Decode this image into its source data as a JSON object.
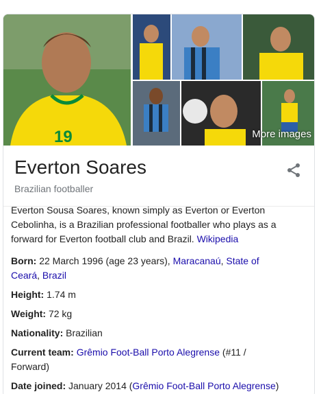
{
  "gallery": {
    "more_images_label": "More images",
    "tiles": [
      "main-portrait",
      "photo-2",
      "photo-3",
      "photo-4",
      "photo-5",
      "photo-6",
      "photo-7"
    ]
  },
  "entity": {
    "name": "Everton Soares",
    "type": "Brazilian footballer",
    "share_icon": "share-icon"
  },
  "description": {
    "text": "Everton Sousa Soares, known simply as Everton or Everton Cebolinha, is a Brazilian professional footballer who plays as a forward for Everton football club and Brazil. ",
    "source_label": "Wikipedia"
  },
  "facts": {
    "born": {
      "label": "Born:",
      "value": " 22 March 1996 (age 23 years), ",
      "link1": "Maracanaú",
      "sep": ", ",
      "link2": "State of Ceará",
      "sep2": ", ",
      "link3": "Brazil"
    },
    "height": {
      "label": "Height:",
      "value": " 1.74 m"
    },
    "weight": {
      "label": "Weight:",
      "value": " 72 kg"
    },
    "nationality": {
      "label": "Nationality:",
      "value": " Brazilian"
    },
    "current_team": {
      "label": "Current team:",
      "link": "Grêmio Foot-Ball Porto Alegrense",
      "suffix": " (#11 / Forward)"
    },
    "date_joined": {
      "label": "Date joined:",
      "value": " January 2014 (",
      "link": "Grêmio Foot-Ball Porto Alegrense",
      "suffix": ")"
    }
  },
  "colors": {
    "link": "#1a0dab",
    "brazil_yellow": "#f5d90a",
    "brazil_green": "#0a8a3a",
    "gremio_blue": "#3b7fc4"
  }
}
